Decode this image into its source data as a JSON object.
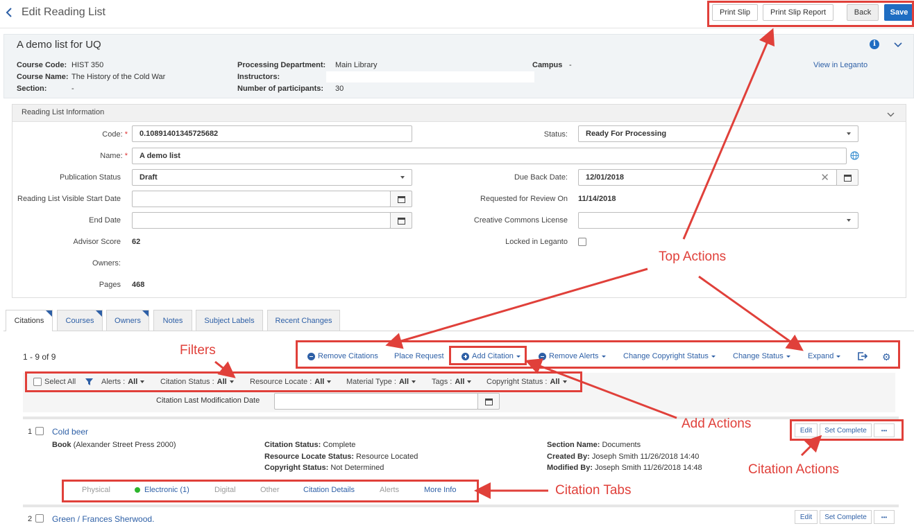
{
  "header": {
    "title": "Edit Reading List",
    "buttons": {
      "print_slip": "Print Slip",
      "print_slip_report": "Print Slip Report",
      "back": "Back",
      "save": "Save"
    }
  },
  "course": {
    "title": "A demo list for UQ",
    "course_code_label": "Course Code:",
    "course_code": "HIST 350",
    "course_name_label": "Course Name:",
    "course_name": "The History of the Cold War",
    "section_label": "Section:",
    "section": "-",
    "processing_dept_label": "Processing Department:",
    "processing_dept": "Main Library",
    "instructors_label": "Instructors:",
    "participants_label": "Number of participants:",
    "participants": "30",
    "campus_label": "Campus",
    "campus": "-",
    "view_in_leganto": "View in Leganto"
  },
  "info": {
    "section_title": "Reading List Information",
    "code_label": "Code:",
    "code": "0.10891401345725682",
    "name_label": "Name:",
    "name": "A demo list",
    "publication_status_label": "Publication Status",
    "publication_status": "Draft",
    "visible_start_label": "Reading List Visible Start Date",
    "end_date_label": "End Date",
    "advisor_score_label": "Advisor Score",
    "advisor_score": "62",
    "owners_label": "Owners:",
    "pages_label": "Pages",
    "pages": "468",
    "status_label": "Status:",
    "status": "Ready For Processing",
    "due_back_label": "Due Back Date:",
    "due_back": "12/01/2018",
    "requested_review_label": "Requested for Review On",
    "requested_review": "11/14/2018",
    "cc_license_label": "Creative Commons License",
    "locked_label": "Locked in Leganto",
    "required_mark": "*"
  },
  "tabs": [
    "Citations",
    "Courses",
    "Owners",
    "Notes",
    "Subject Labels",
    "Recent Changes"
  ],
  "list": {
    "count": "1 - 9 of 9",
    "actions": {
      "remove_citations": "Remove Citations",
      "place_request": "Place Request",
      "add_citation": "Add Citation",
      "remove_alerts": "Remove Alerts",
      "change_copyright": "Change Copyright Status",
      "change_status": "Change Status",
      "expand": "Expand"
    },
    "filters": {
      "select_all": "Select All",
      "alerts": "Alerts :",
      "alerts_val": "All",
      "citation_status": "Citation Status :",
      "citation_status_val": "All",
      "resource_locate": "Resource Locate :",
      "resource_locate_val": "All",
      "material_type": "Material Type :",
      "material_type_val": "All",
      "tags": "Tags :",
      "tags_val": "All",
      "copyright_status": "Copyright Status :",
      "copyright_status_val": "All",
      "last_mod_label": "Citation Last Modification Date"
    }
  },
  "citations": [
    {
      "index": "1",
      "title": "Cold beer",
      "type": "Book",
      "publisher": "(Alexander Street Press 2000)",
      "citation_status_label": "Citation Status:",
      "citation_status": "Complete",
      "resource_locate_label": "Resource Locate Status:",
      "resource_locate": "Resource Located",
      "copyright_label": "Copyright Status:",
      "copyright": "Not Determined",
      "section_label": "Section Name:",
      "section": "Documents",
      "created_label": "Created By:",
      "created": "Joseph Smith 11/26/2018 14:40",
      "modified_label": "Modified By:",
      "modified": "Joseph Smith 11/26/2018 14:48",
      "edit": "Edit",
      "set_complete": "Set Complete",
      "more": "•••"
    },
    {
      "index": "2",
      "title": "Green / Frances Sherwood.",
      "edit": "Edit",
      "set_complete": "Set Complete",
      "more": "•••"
    }
  ],
  "citation_tabs": [
    "Physical",
    "Electronic (1)",
    "Digital",
    "Other",
    "Citation Details",
    "Alerts",
    "More Info"
  ],
  "callouts": {
    "top_actions": "Top Actions",
    "filters": "Filters",
    "add_actions": "Add Actions",
    "citation_actions": "Citation Actions",
    "citation_tabs": "Citation Tabs"
  },
  "colors": {
    "accent": "#1f6dc2",
    "link": "#2d5fa6",
    "annotation": "#e0403a",
    "success": "#2db52d"
  }
}
